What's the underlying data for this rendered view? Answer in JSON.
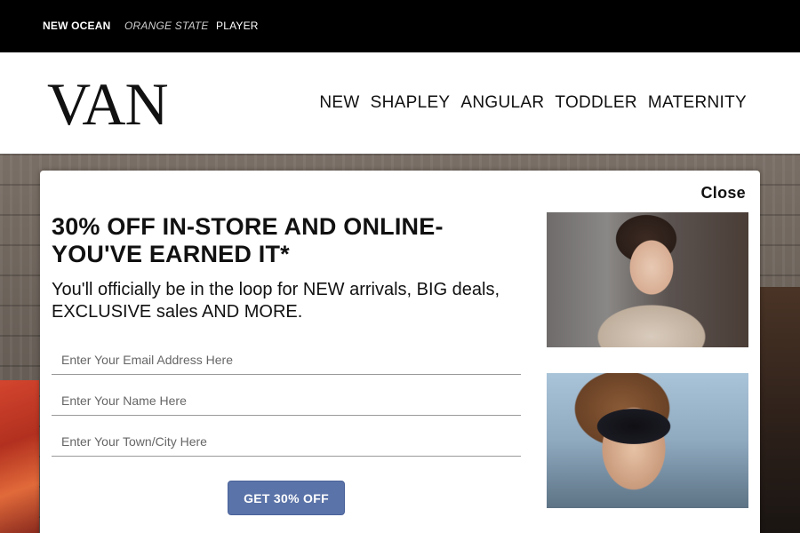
{
  "topbar": {
    "brands": [
      "NEW OCEAN",
      "ORANGE STATE",
      "PLAYER"
    ]
  },
  "header": {
    "logo": "VAN",
    "nav": [
      "NEW",
      "SHAPLEY",
      "ANGULAR",
      "TODDLER",
      "MATERNITY"
    ]
  },
  "modal": {
    "close_label": "Close",
    "headline": "30% OFF IN-STORE AND ONLINE- YOU'VE EARNED IT*",
    "subline": "You'll officially be in the loop for NEW arrivals, BIG deals, EXCLUSIVE sales AND MORE.",
    "fields": {
      "email_placeholder": "Enter Your Email Address Here",
      "email_value": "",
      "name_placeholder": "Enter Your Name Here",
      "name_value": "",
      "town_placeholder": "Enter Your Town/City Here",
      "town_value": ""
    },
    "cta_label": "GET 30% OFF"
  },
  "colors": {
    "topbar_bg": "#000000",
    "cta_bg": "#5a73a8",
    "text": "#111111"
  }
}
